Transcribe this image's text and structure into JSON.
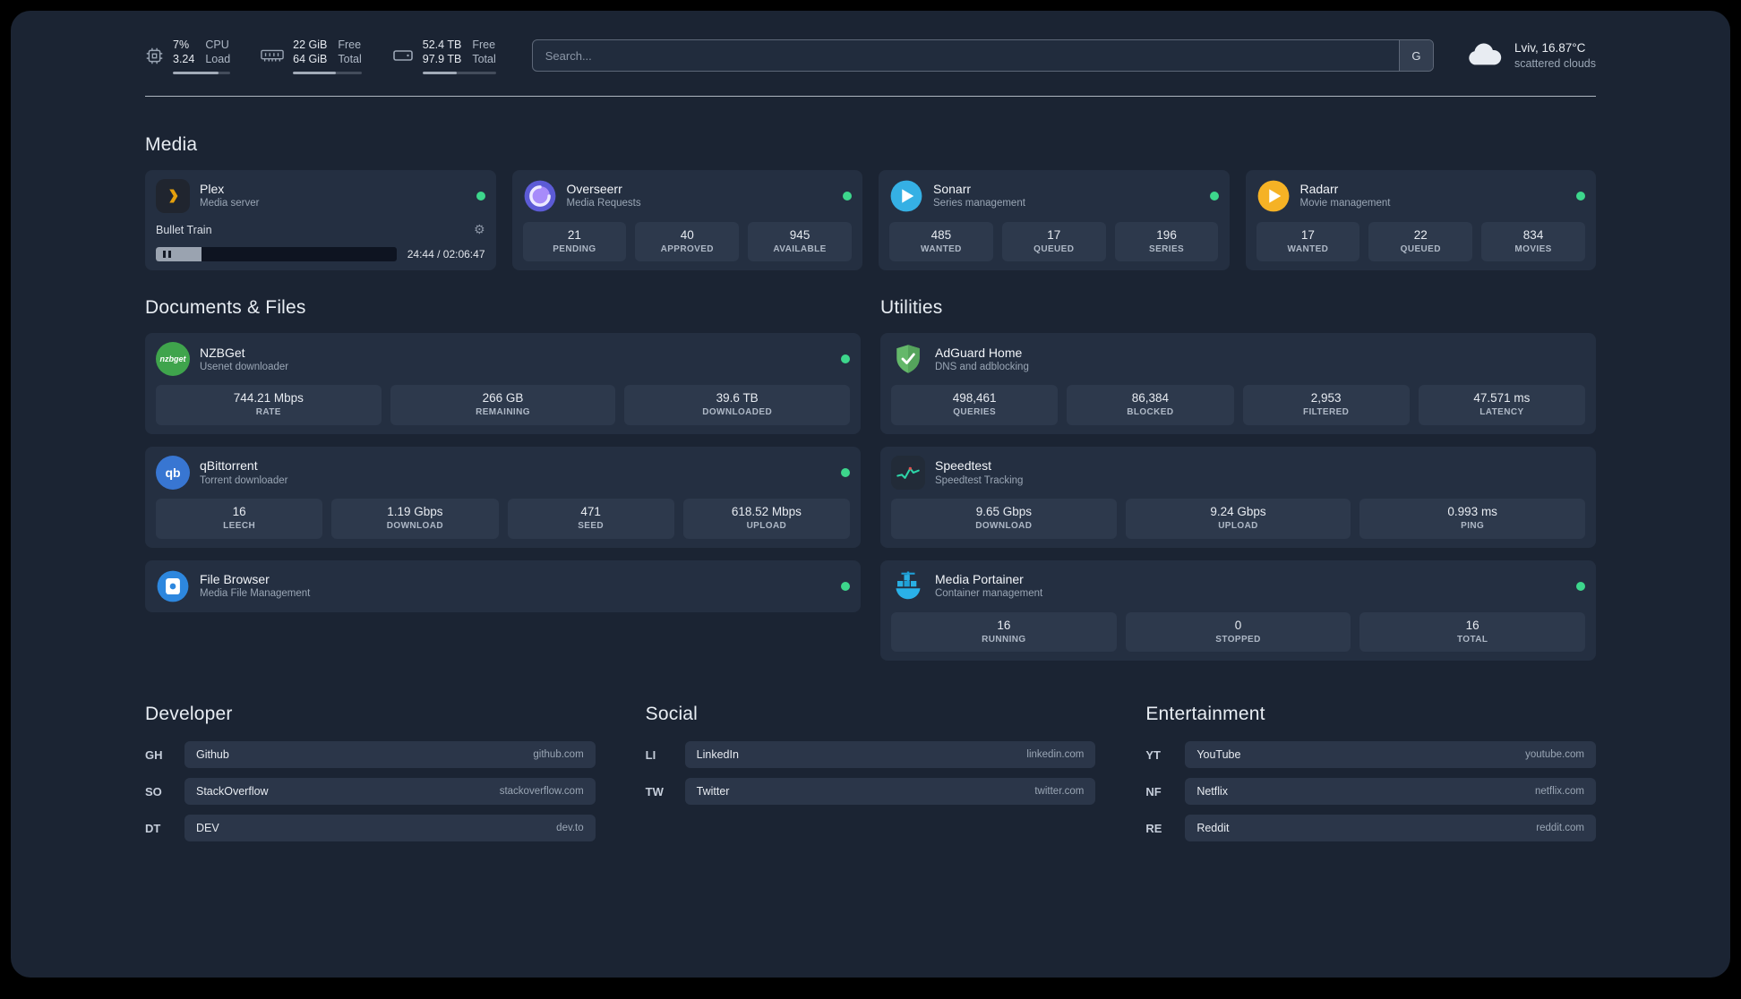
{
  "header": {
    "cpu": {
      "values": [
        "7%",
        "3.24"
      ],
      "labels": [
        "CPU",
        "Load"
      ],
      "percent": 80
    },
    "memory": {
      "values": [
        "22 GiB",
        "64 GiB"
      ],
      "labels": [
        "Free",
        "Total"
      ],
      "percent": 62
    },
    "disk": {
      "values": [
        "52.4 TB",
        "97.9 TB"
      ],
      "labels": [
        "Free",
        "Total"
      ],
      "percent": 47
    },
    "search": {
      "placeholder": "Search...",
      "button_label": "G"
    },
    "weather": {
      "location": "Lviv, 16.87°C",
      "condition": "scattered clouds"
    }
  },
  "media": {
    "title": "Media",
    "plex": {
      "name": "Plex",
      "subtitle": "Media server",
      "status": "online",
      "now_playing": "Bullet Train",
      "time": "24:44 / 02:06:47",
      "progress_percent": 19
    },
    "overseerr": {
      "name": "Overseerr",
      "subtitle": "Media Requests",
      "status": "online",
      "stats": [
        {
          "value": "21",
          "label": "PENDING"
        },
        {
          "value": "40",
          "label": "APPROVED"
        },
        {
          "value": "945",
          "label": "AVAILABLE"
        }
      ]
    },
    "sonarr": {
      "name": "Sonarr",
      "subtitle": "Series management",
      "status": "online",
      "stats": [
        {
          "value": "485",
          "label": "WANTED"
        },
        {
          "value": "17",
          "label": "QUEUED"
        },
        {
          "value": "196",
          "label": "SERIES"
        }
      ]
    },
    "radarr": {
      "name": "Radarr",
      "subtitle": "Movie management",
      "status": "online",
      "stats": [
        {
          "value": "17",
          "label": "WANTED"
        },
        {
          "value": "22",
          "label": "QUEUED"
        },
        {
          "value": "834",
          "label": "MOVIES"
        }
      ]
    }
  },
  "documents": {
    "title": "Documents & Files",
    "nzbget": {
      "name": "NZBGet",
      "subtitle": "Usenet downloader",
      "status": "online",
      "icon_text": "nzbget",
      "stats": [
        {
          "value": "744.21 Mbps",
          "label": "RATE"
        },
        {
          "value": "266 GB",
          "label": "REMAINING"
        },
        {
          "value": "39.6 TB",
          "label": "DOWNLOADED"
        }
      ]
    },
    "qbittorrent": {
      "name": "qBittorrent",
      "subtitle": "Torrent downloader",
      "status": "online",
      "icon_text": "qb",
      "stats": [
        {
          "value": "16",
          "label": "LEECH"
        },
        {
          "value": "1.19 Gbps",
          "label": "DOWNLOAD"
        },
        {
          "value": "471",
          "label": "SEED"
        },
        {
          "value": "618.52 Mbps",
          "label": "UPLOAD"
        }
      ]
    },
    "filebrowser": {
      "name": "File Browser",
      "subtitle": "Media File Management",
      "status": "online"
    }
  },
  "utilities": {
    "title": "Utilities",
    "adguard": {
      "name": "AdGuard Home",
      "subtitle": "DNS and adblocking",
      "stats": [
        {
          "value": "498,461",
          "label": "QUERIES"
        },
        {
          "value": "86,384",
          "label": "BLOCKED"
        },
        {
          "value": "2,953",
          "label": "FILTERED"
        },
        {
          "value": "47.571 ms",
          "label": "LATENCY"
        }
      ]
    },
    "speedtest": {
      "name": "Speedtest",
      "subtitle": "Speedtest Tracking",
      "stats": [
        {
          "value": "9.65 Gbps",
          "label": "DOWNLOAD"
        },
        {
          "value": "9.24 Gbps",
          "label": "UPLOAD"
        },
        {
          "value": "0.993 ms",
          "label": "PING"
        }
      ]
    },
    "portainer": {
      "name": "Media Portainer",
      "subtitle": "Container management",
      "status": "online",
      "stats": [
        {
          "value": "16",
          "label": "RUNNING"
        },
        {
          "value": "0",
          "label": "STOPPED"
        },
        {
          "value": "16",
          "label": "TOTAL"
        }
      ]
    }
  },
  "bookmarks": [
    {
      "title": "Developer",
      "items": [
        {
          "abbr": "GH",
          "name": "Github",
          "url": "github.com"
        },
        {
          "abbr": "SO",
          "name": "StackOverflow",
          "url": "stackoverflow.com"
        },
        {
          "abbr": "DT",
          "name": "DEV",
          "url": "dev.to"
        }
      ]
    },
    {
      "title": "Social",
      "items": [
        {
          "abbr": "LI",
          "name": "LinkedIn",
          "url": "linkedin.com"
        },
        {
          "abbr": "TW",
          "name": "Twitter",
          "url": "twitter.com"
        }
      ]
    },
    {
      "title": "Entertainment",
      "items": [
        {
          "abbr": "YT",
          "name": "YouTube",
          "url": "youtube.com"
        },
        {
          "abbr": "NF",
          "name": "Netflix",
          "url": "netflix.com"
        },
        {
          "abbr": "RE",
          "name": "Reddit",
          "url": "reddit.com"
        }
      ]
    }
  ]
}
